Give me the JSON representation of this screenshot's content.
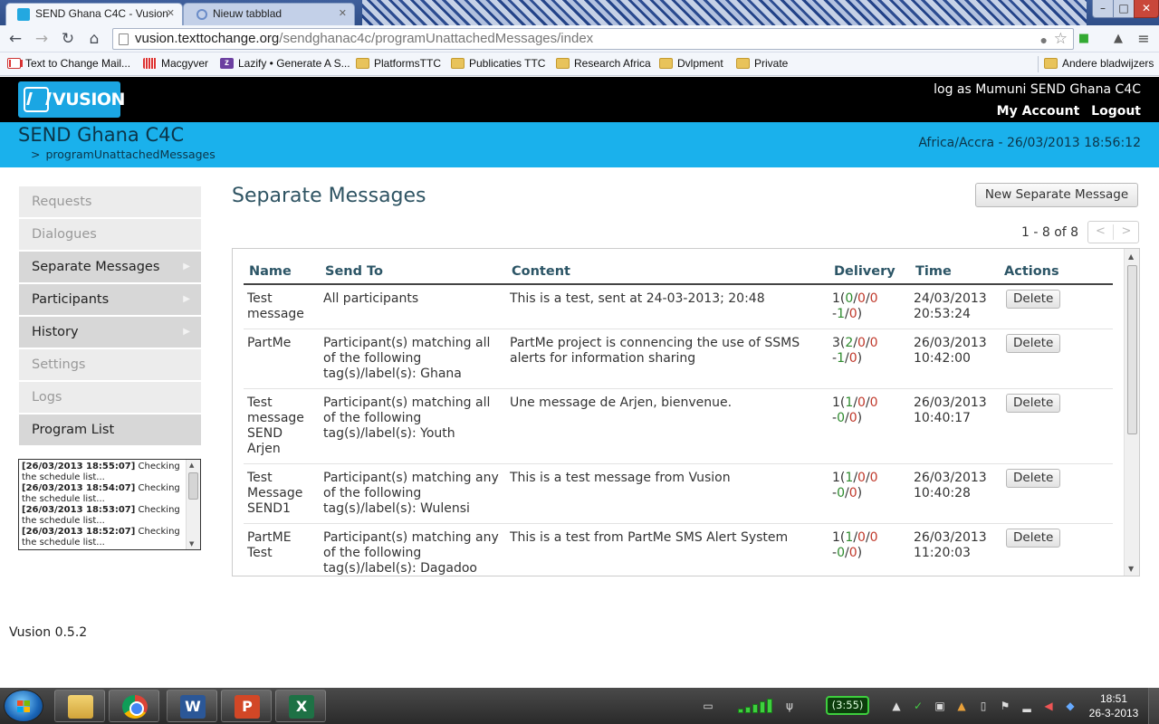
{
  "browser": {
    "tabs": [
      {
        "title": "SEND Ghana C4C - Vusion",
        "active": true
      },
      {
        "title": "Nieuw tabblad",
        "active": false
      }
    ],
    "url_host": "vusion.texttochange.org",
    "url_path": "/sendghanac4c/programUnattachedMessages/index",
    "bookmarks": [
      {
        "label": "Text to Change Mail...",
        "icon": "gmail-icon"
      },
      {
        "label": "Macgyver",
        "icon": "macgyver-icon"
      },
      {
        "label": "Lazify • Generate A S...",
        "icon": "lazify-icon"
      },
      {
        "label": "PlatformsTTC",
        "icon": "folder-icon"
      },
      {
        "label": "Publicaties TTC",
        "icon": "folder-icon"
      },
      {
        "label": "Research Africa",
        "icon": "folder-icon"
      },
      {
        "label": "Dvlpment",
        "icon": "folder-icon"
      },
      {
        "label": "Private",
        "icon": "folder-icon"
      }
    ],
    "other_bookmarks": "Andere bladwijzers"
  },
  "app": {
    "logo_text": "VUSION",
    "log_as": "log as Mumuni SEND Ghana C4C",
    "my_account": "My Account",
    "logout": "Logout",
    "program_name": "SEND Ghana C4C",
    "breadcrumb_sep": ">",
    "breadcrumb": "programUnattachedMessages",
    "timezone_clock": "Africa/Accra - 26/03/2013 18:56:12",
    "version": "Vusion 0.5.2",
    "colors": {
      "topbar": "#000000",
      "accent": "#1ab1ec",
      "delivered": "#2e8b2e",
      "failed": "#c0392b"
    }
  },
  "sidebar": {
    "items": [
      {
        "label": "Requests",
        "active": false
      },
      {
        "label": "Dialogues",
        "active": false
      },
      {
        "label": "Separate Messages",
        "active": true
      },
      {
        "label": "Participants",
        "active": true
      },
      {
        "label": "History",
        "active": true
      },
      {
        "label": "Settings",
        "active": false
      },
      {
        "label": "Logs",
        "active": false
      },
      {
        "label": "Program List",
        "active": true
      }
    ],
    "log_lines": [
      {
        "ts": "[26/03/2013 18:55:07]",
        "msg": " Checking the schedule list..."
      },
      {
        "ts": "[26/03/2013 18:54:07]",
        "msg": " Checking the schedule list..."
      },
      {
        "ts": "[26/03/2013 18:53:07]",
        "msg": " Checking the schedule list..."
      },
      {
        "ts": "[26/03/2013 18:52:07]",
        "msg": " Checking the schedule list..."
      }
    ]
  },
  "main": {
    "title": "Separate Messages",
    "new_button": "New Separate Message",
    "pager_text": "1 - 8 of 8",
    "pager_prev": "<",
    "pager_next": ">",
    "columns": [
      "Name",
      "Send To",
      "Content",
      "Delivery",
      "Time",
      "Actions"
    ],
    "rows": [
      {
        "name": "Test message",
        "send_to": "All participants",
        "content": "This is a test, sent at 24-03-2013; 20:48",
        "delivery": {
          "total": "1",
          "a": "0",
          "b": "0",
          "c": "0",
          "d": "1",
          "e": "0"
        },
        "time_date": "24/03/2013",
        "time_clock": "20:53:24",
        "action": "Delete"
      },
      {
        "name": "PartMe",
        "send_to": "Participant(s) matching all of the following tag(s)/label(s): Ghana",
        "content": "PartMe project is connencing the use of SSMS alerts for information sharing",
        "delivery": {
          "total": "3",
          "a": "2",
          "b": "0",
          "c": "0",
          "d": "1",
          "e": "0"
        },
        "time_date": "26/03/2013",
        "time_clock": "10:42:00",
        "action": "Delete"
      },
      {
        "name": "Test message SEND Arjen",
        "send_to": "Participant(s) matching all of the following tag(s)/label(s): Youth",
        "content": "Une message de Arjen, bienvenue.",
        "delivery": {
          "total": "1",
          "a": "1",
          "b": "0",
          "c": "0",
          "d": "0",
          "e": "0"
        },
        "time_date": "26/03/2013",
        "time_clock": "10:40:17",
        "action": "Delete"
      },
      {
        "name": "Test Message SEND1",
        "send_to": "Participant(s) matching any of the following tag(s)/label(s): Wulensi",
        "content": "This is a test message from Vusion",
        "delivery": {
          "total": "1",
          "a": "1",
          "b": "0",
          "c": "0",
          "d": "0",
          "e": "0"
        },
        "time_date": "26/03/2013",
        "time_clock": "10:40:28",
        "action": "Delete"
      },
      {
        "name": "PartME Test",
        "send_to": "Participant(s) matching any of the following tag(s)/label(s): Dagadoo",
        "content": "This is a test from PartMe SMS Alert System",
        "delivery": {
          "total": "1",
          "a": "1",
          "b": "0",
          "c": "0",
          "d": "0",
          "e": "0"
        },
        "time_date": "26/03/2013",
        "time_clock": "11:20:03",
        "action": "Delete"
      }
    ]
  },
  "taskbar": {
    "apps": [
      "windows-explorer",
      "google-chrome",
      "microsoft-word",
      "microsoft-powerpoint",
      "microsoft-excel"
    ],
    "battery": "(3:55)",
    "time": "18:51",
    "date": "26-3-2013"
  }
}
